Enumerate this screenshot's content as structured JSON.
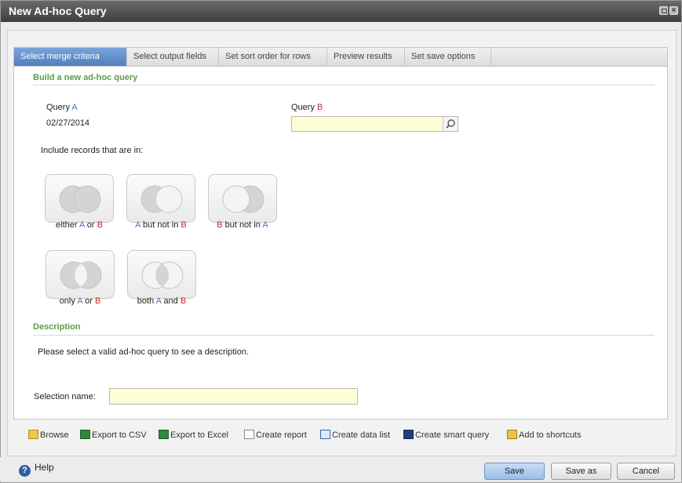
{
  "window": {
    "title": "New Ad-hoc Query"
  },
  "tabs": [
    {
      "label": "Select merge criteria",
      "active": true
    },
    {
      "label": "Select output fields",
      "active": false
    },
    {
      "label": "Set sort order for rows",
      "active": false
    },
    {
      "label": "Preview results",
      "active": false
    },
    {
      "label": "Set save options",
      "active": false
    }
  ],
  "build": {
    "heading": "Build a new ad-hoc query",
    "query_a_label": "Query",
    "query_a_letter": "A",
    "query_a_value": "02/27/2014",
    "query_b_label": "Query",
    "query_b_letter": "B",
    "query_b_value": "",
    "include_label": "Include records that are in:"
  },
  "options": [
    {
      "pre": "either ",
      "l1": "A",
      "mid": " or ",
      "l2": "B",
      "post": ""
    },
    {
      "pre": "",
      "l1": "A",
      "mid": " but not in ",
      "l2": "B",
      "post": ""
    },
    {
      "pre": "",
      "l1": "B",
      "mid": " but not in ",
      "l2": "A",
      "post": ""
    },
    {
      "pre": "only ",
      "l1": "A",
      "mid": " or ",
      "l2": "B",
      "post": ""
    },
    {
      "pre": "both ",
      "l1": "A",
      "mid": " and ",
      "l2": "B",
      "post": ""
    }
  ],
  "description": {
    "heading": "Description",
    "text": "Please select a valid ad-hoc query to see a description."
  },
  "selection": {
    "label": "Selection name:",
    "value": ""
  },
  "toolbar": {
    "browse": "Browse",
    "export_csv": "Export to CSV",
    "export_excel": "Export to Excel",
    "create_report": "Create report",
    "create_data_list": "Create data list",
    "create_smart_query": "Create smart query",
    "add_shortcuts": "Add to shortcuts"
  },
  "footer": {
    "help": "Help",
    "save": "Save",
    "save_as": "Save as",
    "cancel": "Cancel"
  },
  "colors": {
    "letter_a": "#3a78c8",
    "letter_b": "#c8252a",
    "section": "#5f9b48",
    "input_bg": "#fdfdd8"
  }
}
